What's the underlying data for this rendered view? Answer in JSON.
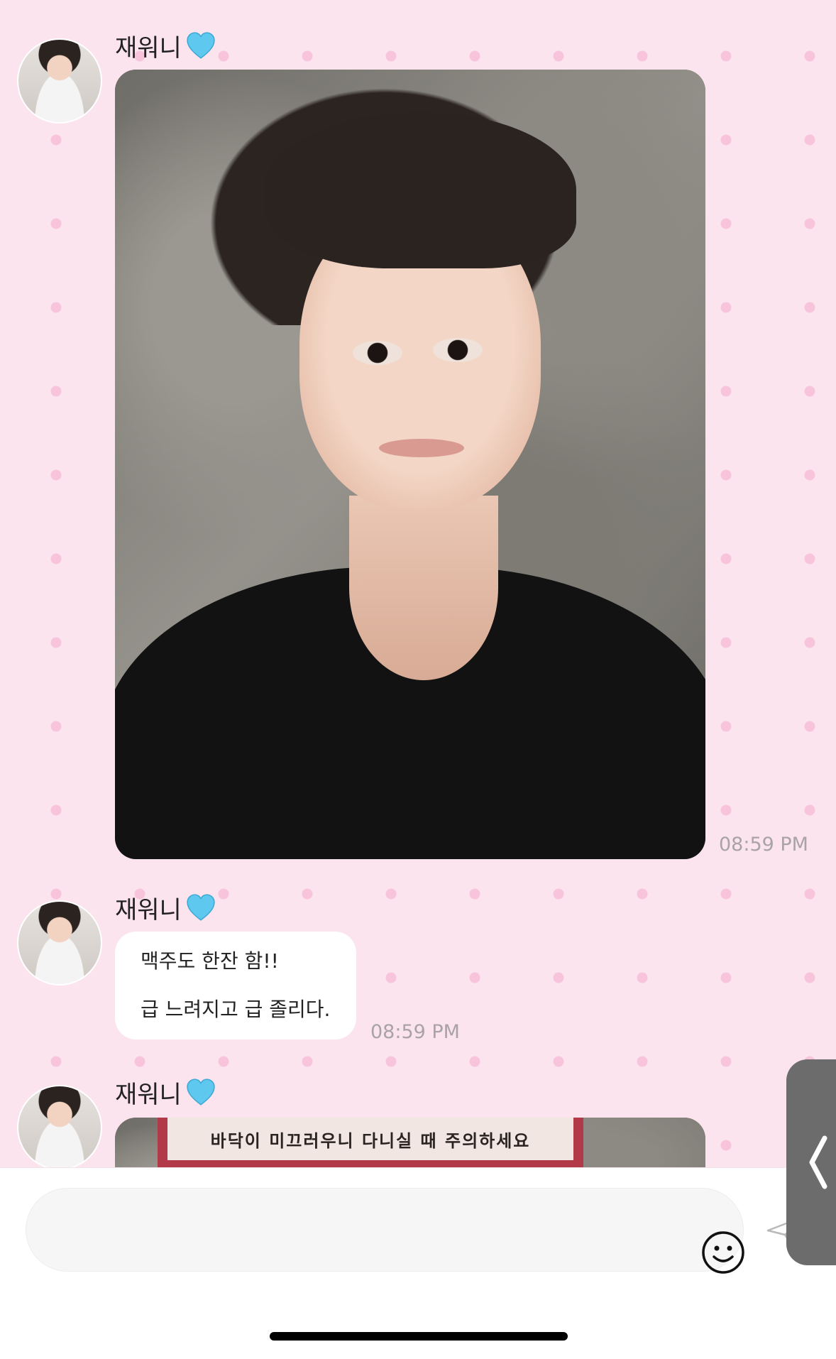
{
  "messages": [
    {
      "sender": "재워니",
      "type": "photo",
      "time": "08:59 PM"
    },
    {
      "sender": "재워니",
      "type": "text",
      "lines": [
        "맥주도 한잔 함!!",
        "급 느려지고 급 졸리다."
      ],
      "time": "08:59 PM"
    },
    {
      "sender": "재워니",
      "type": "photo",
      "sign_text": "바닥이 미끄러우니 다니실 때 주의하세요"
    }
  ],
  "icons": {
    "sender_badge": "blue-heart-icon",
    "emoji": "smiley-face-icon",
    "send": "paper-plane-icon",
    "side_tab": "chevron-left-icon"
  },
  "colors": {
    "background": "#fce4ef",
    "heart": "#5ec8ee"
  }
}
